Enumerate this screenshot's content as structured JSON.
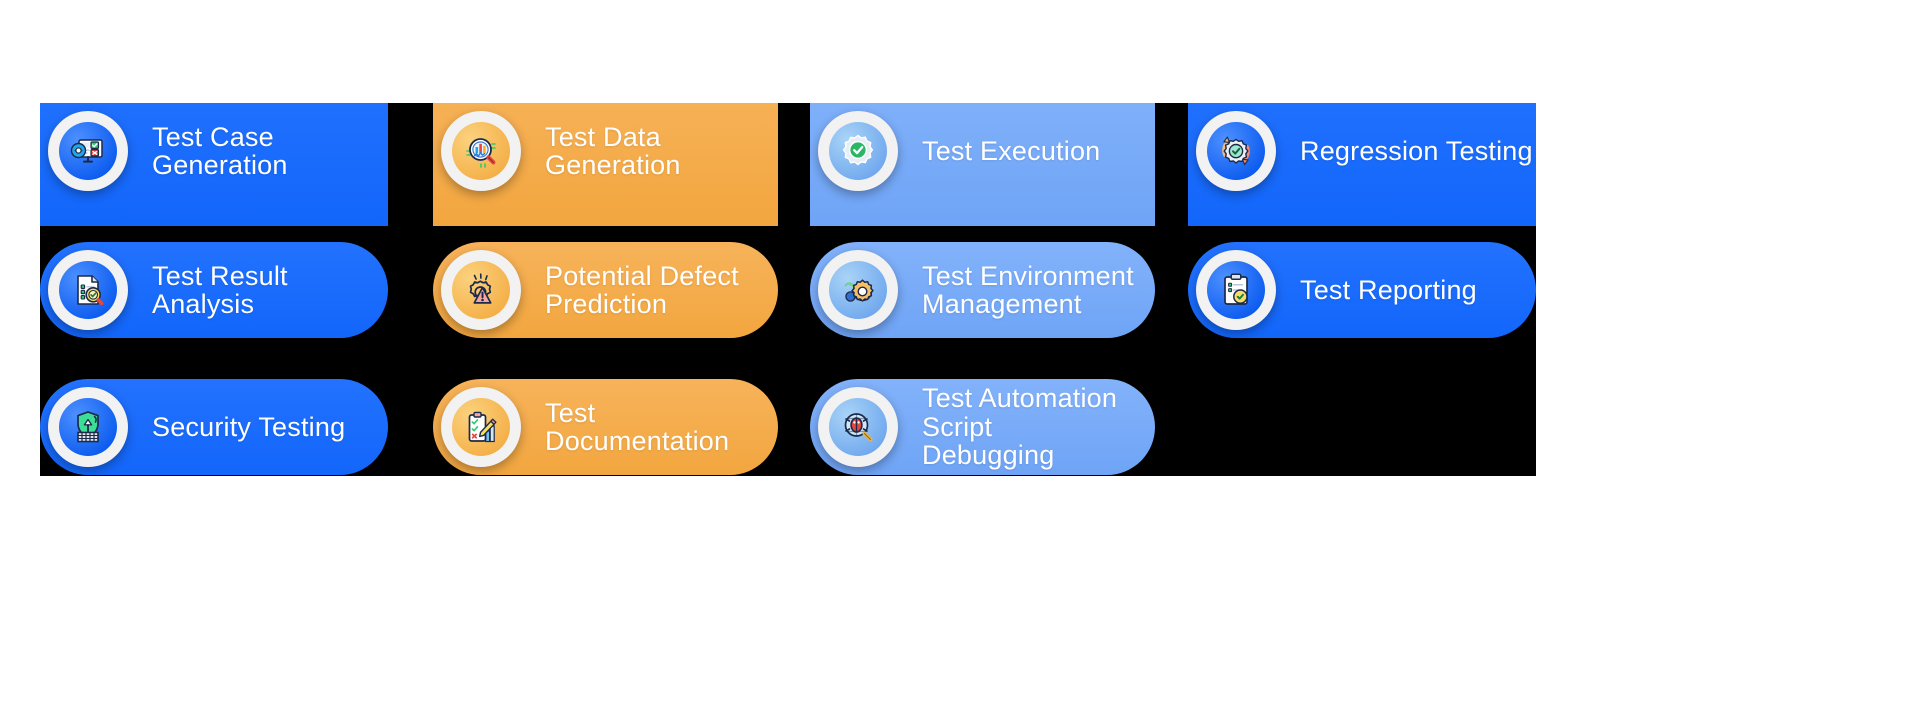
{
  "canvas": {
    "background": "#ffffff",
    "panel_background": "#000000"
  },
  "palette": {
    "blue": "#1266FA",
    "orange": "#F2A63F",
    "light_blue": "#6FA4F6",
    "label_color": "#ffffff"
  },
  "grid": {
    "rows": 3,
    "columns": 4
  },
  "cards": [
    {
      "id": "test-case-generation",
      "label": "Test Case Generation",
      "tone": "blue",
      "icon": "monitor-code-checklist-icon",
      "row": 1,
      "column": 1,
      "clipped": true
    },
    {
      "id": "test-data-generation",
      "label": "Test Data Generation",
      "tone": "orange",
      "icon": "magnifier-bar-chart-icon",
      "row": 1,
      "column": 2,
      "clipped": true
    },
    {
      "id": "test-execution",
      "label": "Test Execution",
      "tone": "light_blue",
      "icon": "gear-check-icon",
      "row": 1,
      "column": 3,
      "clipped": true
    },
    {
      "id": "regression-testing",
      "label": "Regression Testing",
      "tone": "blue",
      "icon": "refresh-gear-check-icon",
      "row": 1,
      "column": 4,
      "clipped": true
    },
    {
      "id": "test-result-analysis",
      "label": "Test Result Analysis",
      "tone": "blue",
      "icon": "document-magnifier-check-icon",
      "row": 2,
      "column": 1,
      "clipped": false
    },
    {
      "id": "potential-defect-prediction",
      "label": "Potential Defect\nPrediction",
      "tone": "orange",
      "icon": "gear-warning-icon",
      "row": 2,
      "column": 2,
      "clipped": false
    },
    {
      "id": "test-environment-management",
      "label": "Test Environment\nManagement",
      "tone": "light_blue",
      "icon": "cloud-gear-icon",
      "row": 2,
      "column": 3,
      "clipped": false
    },
    {
      "id": "test-reporting",
      "label": "Test Reporting",
      "tone": "blue",
      "icon": "clipboard-report-icon",
      "row": 2,
      "column": 4,
      "clipped": false
    },
    {
      "id": "security-testing",
      "label": "Security Testing",
      "tone": "blue",
      "icon": "shield-bug-icon",
      "row": 3,
      "column": 1,
      "clipped": false
    },
    {
      "id": "test-documentation",
      "label": "Test Documentation",
      "tone": "orange",
      "icon": "clipboard-pencil-icon",
      "row": 3,
      "column": 2,
      "clipped": false
    },
    {
      "id": "test-automation-script-debugging",
      "label": "Test Automation Script\nDebugging",
      "tone": "light_blue",
      "icon": "bug-magnifier-icon",
      "row": 3,
      "column": 3,
      "clipped": false
    }
  ]
}
